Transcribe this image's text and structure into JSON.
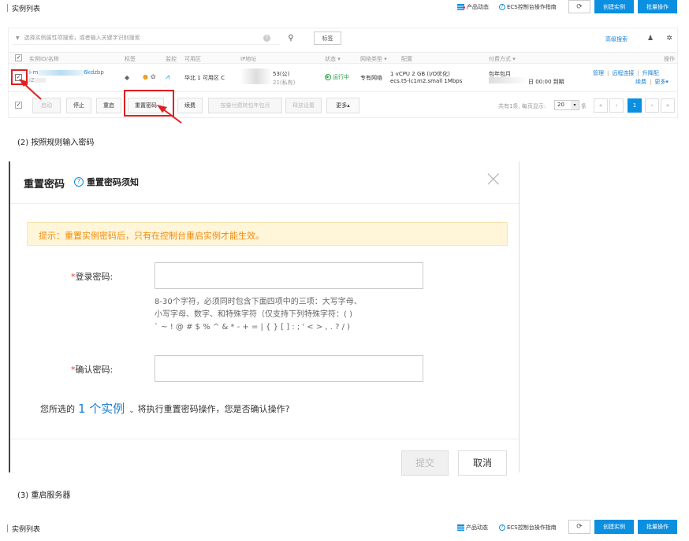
{
  "top_bar": {
    "title": "实例列表",
    "product_news": "产品动态",
    "ecs_guide": "ECS控制台操作指南",
    "create_instance": "创建实例",
    "batch_ops": "批量操作"
  },
  "filter": {
    "placeholder": "选择实例属性项搜索，或者输入关键字识别搜索",
    "tag_btn": "标签",
    "advanced_search": "高级搜索"
  },
  "table": {
    "headers": [
      "实例ID/名称",
      "标签",
      "监控",
      "可用区",
      "IP地址",
      "状态",
      "网络类型",
      "配置",
      "付费方式",
      "操作"
    ],
    "row": {
      "id": "i-m",
      "id_tail": "6kdzbp",
      "name": "iZ",
      "zone": "华北 1 可用区 C",
      "ip_public": "53(公)",
      "ip_private": "21(私有)",
      "status": "运行中",
      "network": "专有网络",
      "config_line1": "1 vCPU 2 GB (I/O优化)",
      "config_line2": "ecs.t5-lc1m2.small  1Mbps",
      "billing_line1": "包年包月",
      "billing_line2": "日 00:00 到期",
      "op_manage": "管理",
      "op_remote": "远程连接",
      "op_upgrade": "升降配",
      "op_renew": "续费",
      "op_more": "更多"
    }
  },
  "toolbar": {
    "start": "启动",
    "stop": "停止",
    "restart": "重启",
    "reset_pwd": "重置密码",
    "renew": "续费",
    "pay_convert": "按量付费转包年包月",
    "release": "释放设置",
    "more": "更多",
    "page_info": "共有1条, 每页显示:",
    "page_size": "20",
    "page_unit": "条",
    "current_page": "1"
  },
  "captions": {
    "step2": "(2) 按照规则输入密码",
    "step3": "(3) 重启服务器"
  },
  "dialog": {
    "title": "重置密码",
    "help_link": "重置密码须知",
    "close": "×",
    "notice": "提示：重置实例密码后，只有在控制台重启实例才能生效。",
    "login_pwd_label": "登录密码:",
    "confirm_pwd_label": "确认密码:",
    "req_mark": "*",
    "rule_line1": "8-30个字符，必须同时包含下面四项中的三项：大写字母、",
    "rule_line2": "小写字母、数字、和特殊字符（仅支持下列特殊字符：( )",
    "rule_line3": "` ~ ! @ # $ % ^ & * - + = | { } [ ] : ; ' < > , . ? / )",
    "selected_prefix": "您所选的",
    "selected_count": "1 个实例",
    "selected_suffix": "将执行重置密码操作，您是否确认操作?",
    "submit": "提交",
    "cancel": "取消"
  },
  "colors": {
    "accent": "#0b8fe0",
    "highlight_red": "#e02020",
    "running_green": "#2ba245",
    "notice_bg": "#fff6d9",
    "notice_text": "#f28a0b"
  }
}
